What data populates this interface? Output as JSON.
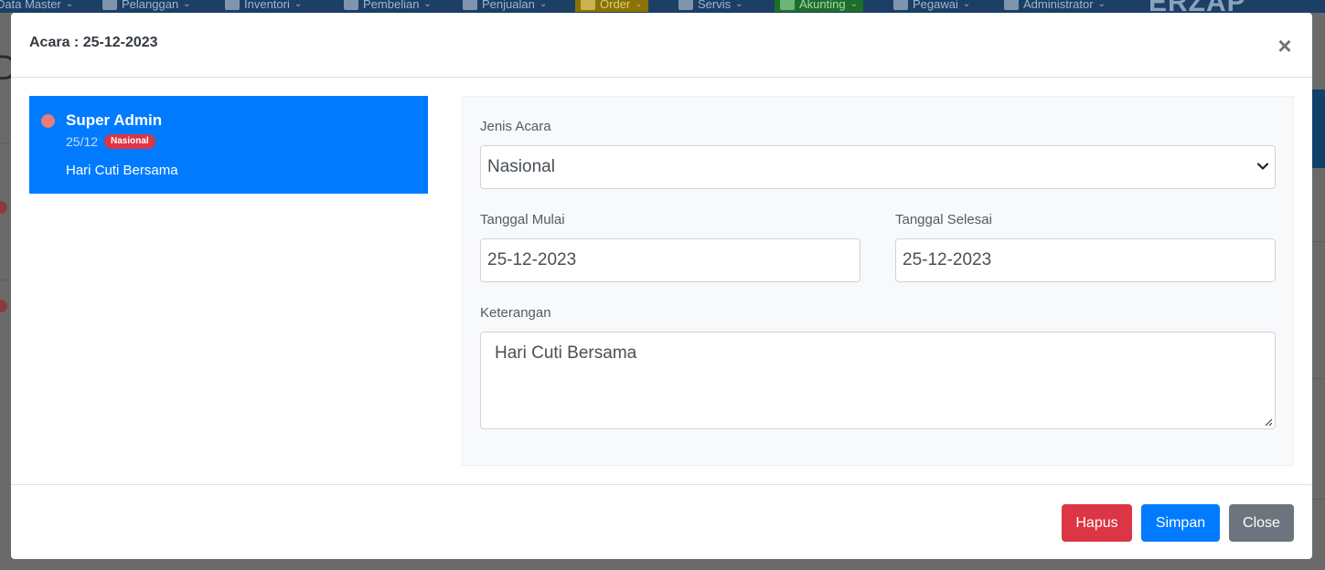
{
  "background_nav": {
    "items": [
      {
        "label": "Data Master"
      },
      {
        "label": "Pelanggan"
      },
      {
        "label": "Inventori"
      },
      {
        "label": "Pembelian"
      },
      {
        "label": "Penjualan"
      },
      {
        "label": "Order"
      },
      {
        "label": "Servis"
      },
      {
        "label": "Akunting"
      },
      {
        "label": "Pegawai"
      },
      {
        "label": "Administrator"
      }
    ],
    "logo": "ERZAP"
  },
  "modal": {
    "title": "Acara : 25-12-2023",
    "close_symbol": "×",
    "event": {
      "name": "Super Admin",
      "date": "25/12",
      "badge": "Nasional",
      "description": "Hari Cuti Bersama",
      "dot_color": "#e87b7b"
    },
    "form": {
      "jenis_acara_label": "Jenis Acara",
      "jenis_acara_value": "Nasional",
      "tanggal_mulai_label": "Tanggal Mulai",
      "tanggal_mulai_value": "25-12-2023",
      "tanggal_selesai_label": "Tanggal Selesai",
      "tanggal_selesai_value": "25-12-2023",
      "keterangan_label": "Keterangan",
      "keterangan_value": "Hari Cuti Bersama"
    },
    "footer": {
      "delete_label": "Hapus",
      "save_label": "Simpan",
      "close_label": "Close"
    }
  },
  "colors": {
    "primary": "#007bff",
    "danger": "#dc3545",
    "secondary": "#6c757d"
  }
}
